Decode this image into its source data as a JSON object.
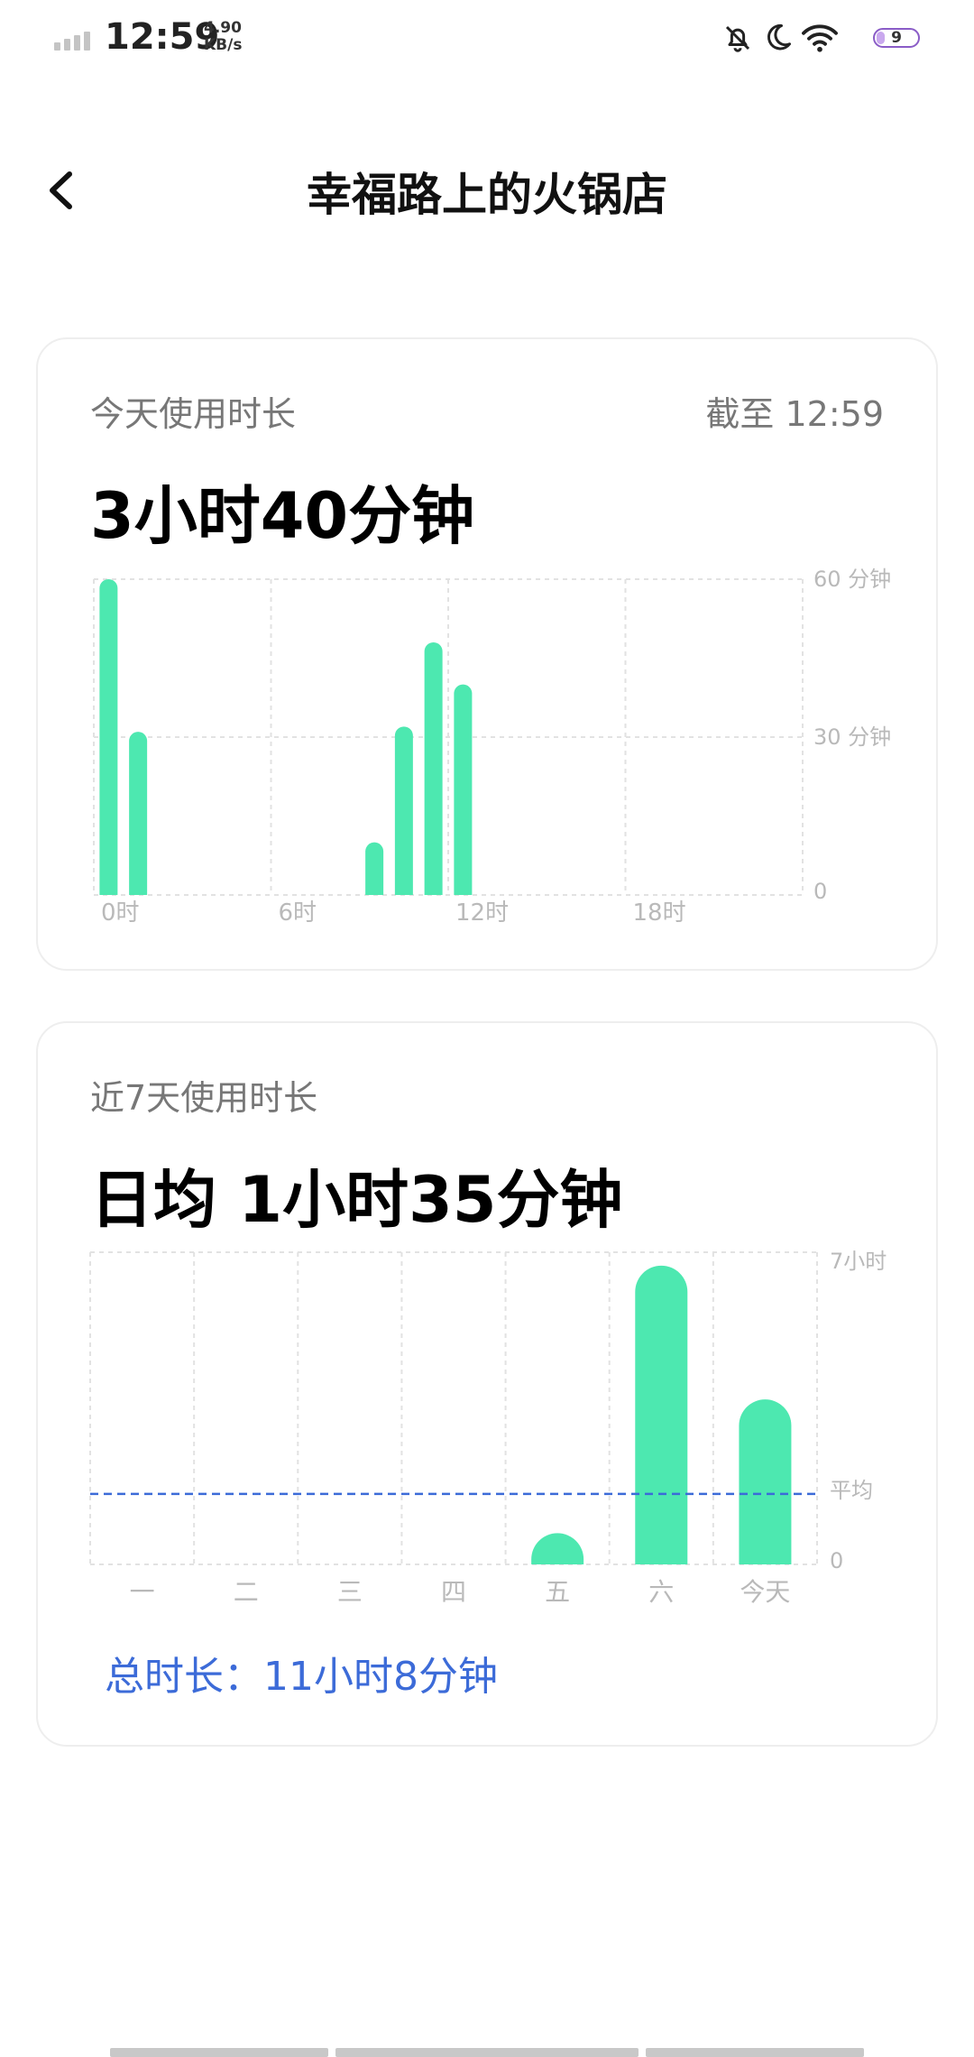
{
  "status": {
    "time": "12:59",
    "speed_value": "4.90",
    "speed_unit": "KB/s",
    "battery": "9",
    "icons": [
      "signal-icon",
      "bell-off-icon",
      "moon-icon",
      "wifi-icon",
      "battery-icon"
    ]
  },
  "header": {
    "title": "幸福路上的火锅店",
    "back_icon": "chevron-left-icon"
  },
  "today": {
    "label": "今天使用时长",
    "as_of": "截至 12:59",
    "total": "3小时40分钟"
  },
  "week": {
    "label": "近7天使用时长",
    "average": "日均 1小时35分钟",
    "total_line": "总时长：11小时8分钟"
  },
  "colors": {
    "bar": "#4de8b0",
    "average_line": "#3c6bd8",
    "total_text": "#3c6bd8"
  },
  "chart_data": [
    {
      "type": "bar",
      "title": "",
      "x": [
        0,
        1,
        9,
        10,
        11,
        12
      ],
      "values": [
        60,
        31,
        10,
        32,
        48,
        40
      ],
      "x_ticks": [
        0,
        6,
        12,
        18
      ],
      "x_tick_labels": [
        "0时",
        "6时",
        "12时",
        "18时"
      ],
      "y_ticks": [
        0,
        30,
        60
      ],
      "y_tick_labels": [
        "0",
        "30 分钟",
        "60 分钟"
      ],
      "xlim": [
        0,
        24
      ],
      "ylim": [
        0,
        60
      ],
      "xlabel": "",
      "ylabel": "",
      "grid": true
    },
    {
      "type": "bar",
      "title": "",
      "categories": [
        "一",
        "二",
        "三",
        "四",
        "五",
        "六",
        "今天"
      ],
      "values": [
        0,
        0,
        0,
        0,
        0.7,
        6.7,
        3.7
      ],
      "y_ticks": [
        0,
        7
      ],
      "y_tick_labels": [
        "0",
        "7小时"
      ],
      "average_label": "平均",
      "average": 1.58,
      "ylim": [
        0,
        7
      ],
      "xlabel": "",
      "ylabel": "",
      "grid": true
    }
  ]
}
